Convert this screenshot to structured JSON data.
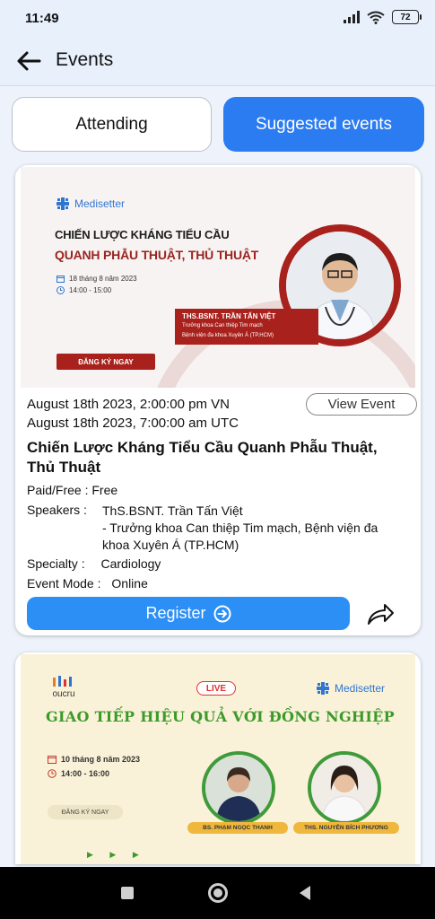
{
  "status": {
    "time": "11:49",
    "battery": "72"
  },
  "header": {
    "title": "Events"
  },
  "tabs": {
    "attending": "Attending",
    "suggested": "Suggested events"
  },
  "event1": {
    "banner": {
      "brand": "Medisetter",
      "headline1": "CHIẾN LƯỢC KHÁNG TIỂU CẦU",
      "headline2": "QUANH PHẪU THUẬT, THỦ THUẬT",
      "date": "18 tháng 8 năm 2023",
      "time": "14:00 - 15:00",
      "speaker_name": "THS.BSNT. TRẦN TẤN VIỆT",
      "speaker_role1": "Trưởng khoa Can thiệp Tim mạch",
      "speaker_role2": "Bệnh viện đa khoa Xuyên Á (TP.HCM)",
      "cta": "ĐĂNG KÝ NGAY"
    },
    "datetime_vn": "August 18th 2023, 2:00:00 pm VN",
    "datetime_utc": "August 18th 2023, 7:00:00 am UTC",
    "view_label": "View Event",
    "title": "Chiến Lược Kháng Tiểu Cầu Quanh Phẫu Thuật, Thủ Thuật",
    "paid_label": "Paid/Free :",
    "paid_value": "Free",
    "speakers_label": "Speakers :",
    "speakers_line1": "ThS.BSNT. Trần Tấn Việt",
    "speakers_line2": "- Trưởng khoa Can thiệp Tim mạch, Bệnh viện đa",
    "speakers_line3": "khoa Xuyên Á (TP.HCM)",
    "specialty_label": "Specialty :",
    "specialty_value": "Cardiology",
    "mode_label": "Event Mode :",
    "mode_value": "Online",
    "register_label": "Register"
  },
  "event2": {
    "banner": {
      "org": "oucru",
      "live": "LIVE",
      "brand": "Medisetter",
      "title": "GIAO TIẾP HIỆU QUẢ VỚI ĐỒNG NGHIỆP",
      "date": "10 tháng 8 năm 2023",
      "time": "14:00 - 16:00",
      "cta": "ĐĂNG KÝ NGAY",
      "arrows": "▶ ▶ ▶",
      "speaker1": "BS. PHẠM NGỌC THANH",
      "speaker2": "THS. NGUYỄN BÍCH PHƯƠNG"
    }
  },
  "colors": {
    "primary": "#2b7cf1",
    "register": "#2b8ff5",
    "banner_red": "#a8211c",
    "title_green": "#3c9a2b"
  },
  "icons": [
    "back-arrow-icon",
    "wifi-icon",
    "signal-icon",
    "battery-icon",
    "share-icon",
    "arrow-right-circle-icon",
    "calendar-icon",
    "clock-icon",
    "medisetter-logo-icon"
  ]
}
